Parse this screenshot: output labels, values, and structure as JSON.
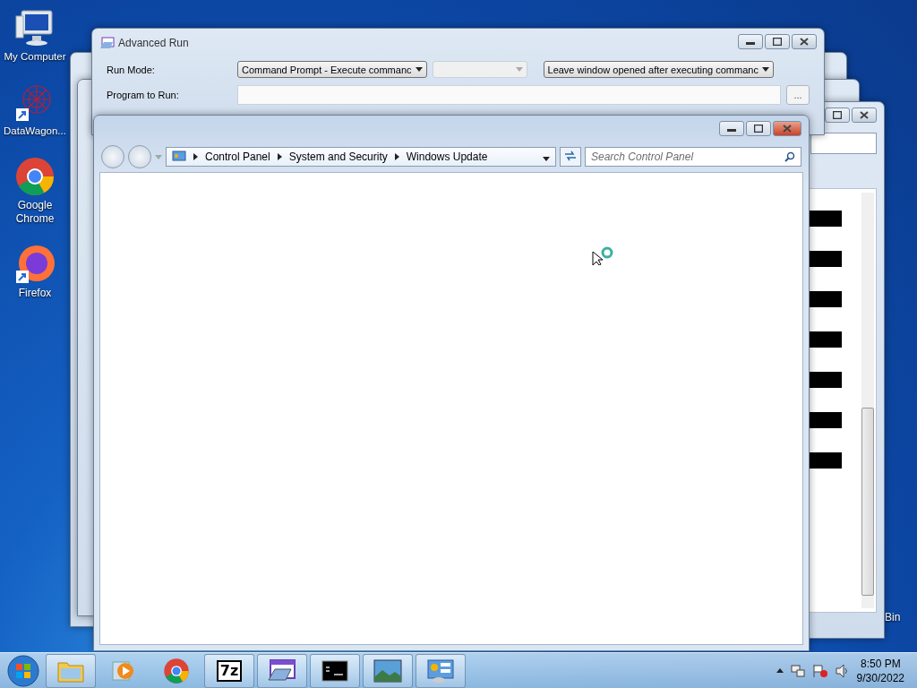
{
  "desktop_icons": [
    {
      "label": "My Computer",
      "kind": "computer"
    },
    {
      "label": "DataWagon...",
      "kind": "datawagon"
    },
    {
      "label": "Google Chrome",
      "kind": "chrome"
    },
    {
      "label": "Firefox",
      "kind": "firefox"
    }
  ],
  "recycle_bin": {
    "label": "Bin"
  },
  "advanced_run": {
    "title": "Advanced Run",
    "run_mode_label": "Run Mode:",
    "run_mode_value": "Command Prompt - Execute commanc",
    "window_option": "Leave window opened after executing commanc",
    "program_label": "Program to Run:",
    "browse_button": "..."
  },
  "control_panel": {
    "breadcrumbs": [
      "Control Panel",
      "System and Security",
      "Windows Update"
    ],
    "search": {
      "placeholder": "Search Control Panel"
    }
  },
  "taskbar": {
    "items": [
      {
        "kind": "explorer"
      },
      {
        "kind": "media"
      },
      {
        "kind": "chrome"
      },
      {
        "kind": "sevenzip",
        "label": "7z"
      },
      {
        "kind": "advrun"
      },
      {
        "kind": "cmd"
      },
      {
        "kind": "photo"
      },
      {
        "kind": "controlpanel"
      }
    ],
    "clock": {
      "time": "8:50 PM",
      "date": "9/30/2022"
    }
  }
}
